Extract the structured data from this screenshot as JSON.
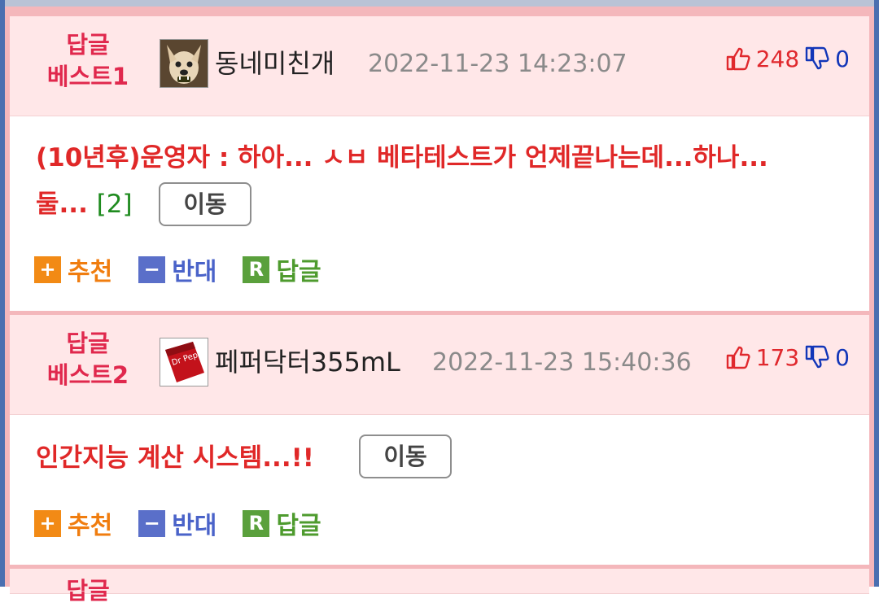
{
  "comments": [
    {
      "rank_line1": "답글",
      "rank_line2": "베스트1",
      "username": "동네미친개",
      "date": "2022-11-23 14:23:07",
      "up_count": "248",
      "down_count": "0",
      "title": "(10년후)운영자 : 하아... ㅅㅂ 베타테스트가 언제끝나는데...하나...",
      "title_line2": "둘...",
      "comment_count": "[2]",
      "move_label": "이동",
      "avatar_icon": "dog-avatar-icon"
    },
    {
      "rank_line1": "답글",
      "rank_line2": "베스트2",
      "username": "페퍼닥터355mL",
      "date": "2022-11-23 15:40:36",
      "up_count": "173",
      "down_count": "0",
      "title": "인간지능 계산 시스템...!!",
      "move_label": "이동",
      "avatar_icon": "soda-can-avatar-icon"
    }
  ],
  "actions": {
    "recommend_label": "추천",
    "oppose_label": "반대",
    "reply_label": "답글",
    "recommend_icon": "+",
    "oppose_icon": "−",
    "reply_icon": "R"
  },
  "third_rank_partial": "답글",
  "colors": {
    "rank": "#e0284d",
    "title": "#e02828",
    "up": "#e0282d",
    "down": "#1236b8",
    "header_bg": "#ffe7e8",
    "border": "#f4b7bb"
  }
}
